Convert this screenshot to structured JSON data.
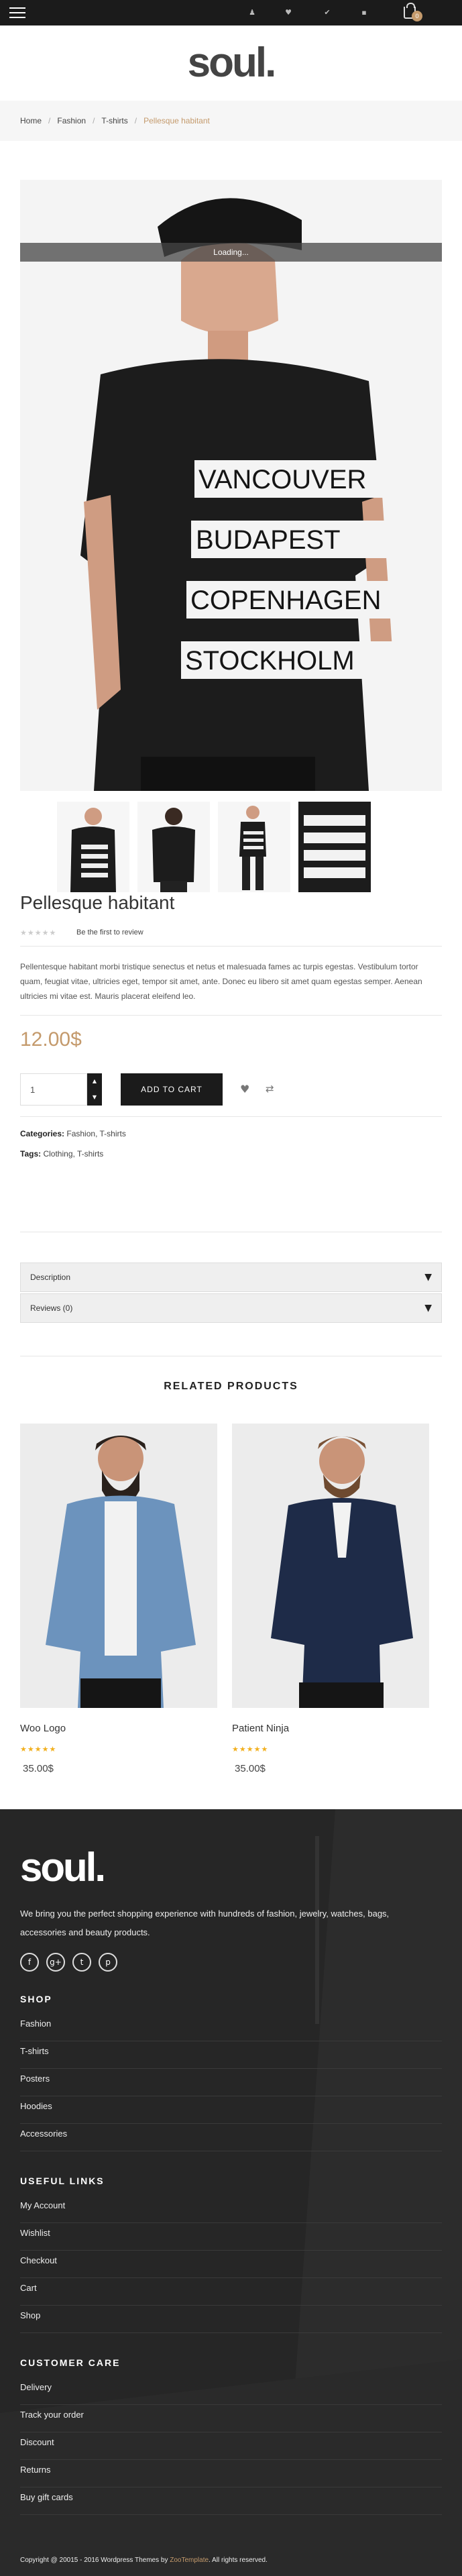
{
  "topbar": {
    "cart_count": "0"
  },
  "header": {
    "logo": "soul."
  },
  "breadcrumb": {
    "items": [
      "Home",
      "Fashion",
      "T-shirts"
    ],
    "current": "Pellesque habitant"
  },
  "gallery": {
    "loading": "Loading..."
  },
  "product": {
    "title": "Pellesque habitant",
    "review_link": "Be the first to review",
    "description": "Pellentesque habitant morbi tristique senectus et netus et malesuada fames ac turpis egestas. Vestibulum tortor quam, feugiat vitae, ultricies eget, tempor sit amet, ante. Donec eu libero sit amet quam egestas semper. Aenean ultricies mi vitae est. Mauris placerat eleifend leo.",
    "price": "12.00$",
    "quantity": "1",
    "add_to_cart": "ADD TO CART",
    "categories_label": "Categories:",
    "categories": "Fashion, T-shirts",
    "tags_label": "Tags:",
    "tags": "Clothing, T-shirts"
  },
  "tabs": [
    {
      "label": "Description"
    },
    {
      "label": "Reviews (0)"
    }
  ],
  "related": {
    "title": "RELATED PRODUCTS",
    "items": [
      {
        "name": "Woo Logo",
        "price": "35.00$",
        "rating": 5
      },
      {
        "name": "Patient Ninja",
        "price": "35.00$",
        "rating": 5
      }
    ]
  },
  "footer": {
    "logo": "soul.",
    "about": "We bring you the perfect shopping experience with hundreds of fashion, jewelry, watches, bags, accessories and beauty products.",
    "social": [
      "f",
      "g+",
      "t",
      "p"
    ],
    "shop": {
      "title": "SHOP",
      "links": [
        "Fashion",
        "T-shirts",
        "Posters",
        "Hoodies",
        "Accessories"
      ]
    },
    "useful": {
      "title": "USEFUL LINKS",
      "links": [
        "My Account",
        "Wishlist",
        "Checkout",
        "Cart",
        "Shop"
      ]
    },
    "care": {
      "title": "CUSTOMER CARE",
      "links": [
        "Delivery",
        "Track your order",
        "Discount",
        "Returns",
        "Buy gift cards"
      ]
    },
    "copyright": "Copyright @ 20015 - 2016 Wordpress Themes by",
    "brand": "ZooTemplate",
    "rights": ". All rights reserved."
  },
  "colors": {
    "accent": "#c49a6c",
    "dark": "#1b1b1b",
    "footer": "#272727",
    "star": "#f2b01e"
  },
  "icons": [
    "menu-icon",
    "user-icon",
    "heart-icon",
    "check-icon",
    "lock-icon",
    "cart-icon",
    "wishlist-icon",
    "compare-icon",
    "chevron-down-icon"
  ]
}
